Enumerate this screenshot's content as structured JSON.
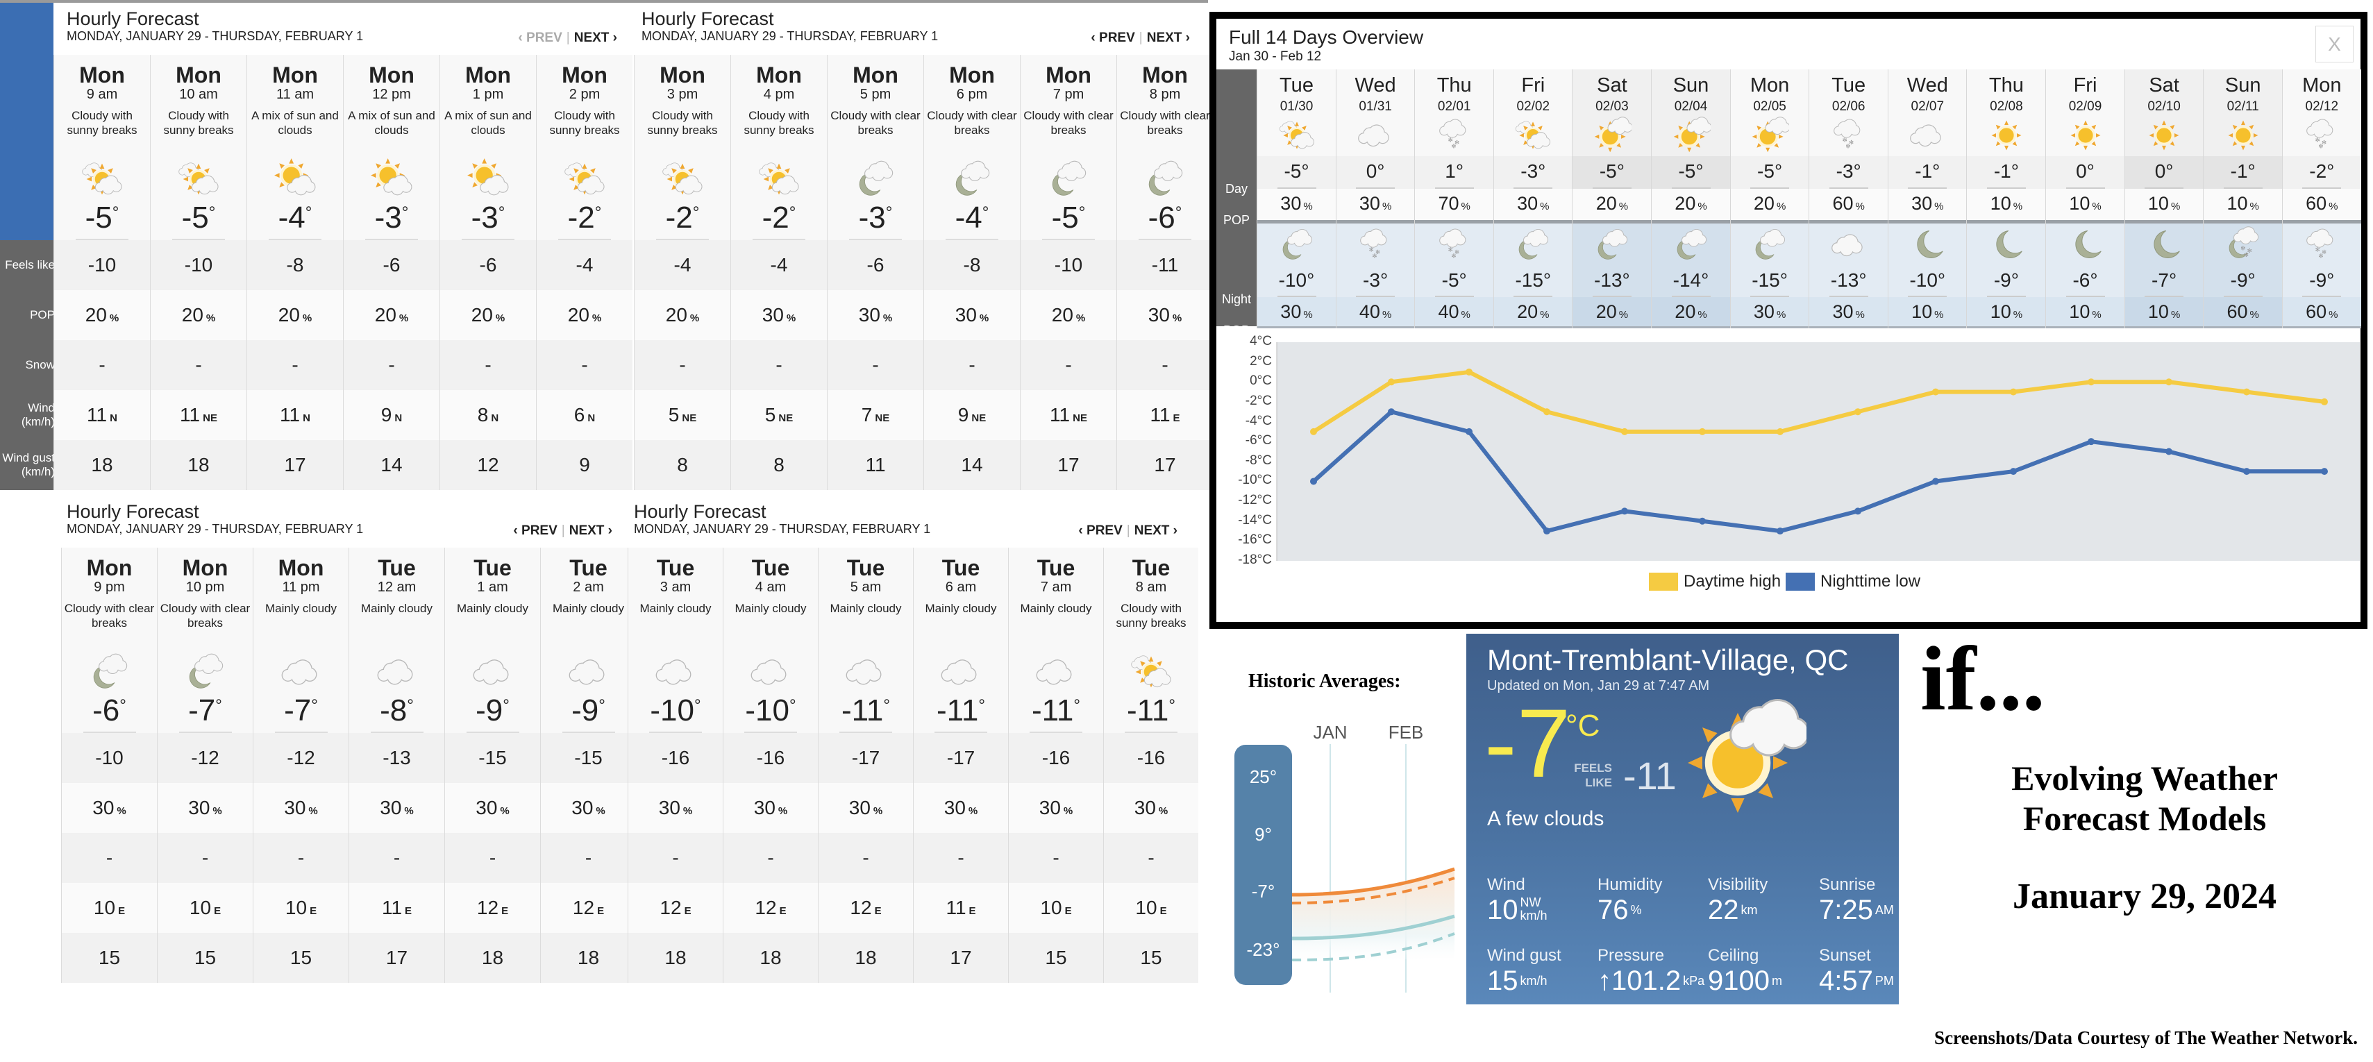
{
  "units": {
    "deg": "°",
    "pct": "%"
  },
  "hourly": {
    "row_labels": [
      "Feels like",
      "POP",
      "Snow",
      "Wind\n(km/h)",
      "Wind gust\n(km/h)"
    ],
    "panels": [
      {
        "title": "Hourly Forecast",
        "subtitle": "MONDAY, JANUARY 29 - THURSDAY, FEBRUARY 1",
        "prev": "‹ PREV",
        "next": "NEXT ›",
        "prev_disabled": true,
        "columns": [
          {
            "day": "Mon",
            "time": "9 am",
            "desc": "Cloudy with sunny breaks",
            "icon": "sun-cloud",
            "temp": "-5",
            "feels": "-10",
            "pop": "20",
            "snow": "-",
            "wind": "11",
            "dir": "N",
            "gust": "18"
          },
          {
            "day": "Mon",
            "time": "10 am",
            "desc": "Cloudy with sunny breaks",
            "icon": "sun-cloud",
            "temp": "-5",
            "feels": "-10",
            "pop": "20",
            "snow": "-",
            "wind": "11",
            "dir": "NE",
            "gust": "18"
          },
          {
            "day": "Mon",
            "time": "11 am",
            "desc": "A mix of sun and clouds",
            "icon": "mix-sun-cloud",
            "temp": "-4",
            "feels": "-8",
            "pop": "20",
            "snow": "-",
            "wind": "11",
            "dir": "N",
            "gust": "17"
          },
          {
            "day": "Mon",
            "time": "12 pm",
            "desc": "A mix of sun and clouds",
            "icon": "mix-sun-cloud",
            "temp": "-3",
            "feels": "-6",
            "pop": "20",
            "snow": "-",
            "wind": "9",
            "dir": "N",
            "gust": "14"
          },
          {
            "day": "Mon",
            "time": "1 pm",
            "desc": "A mix of sun and clouds",
            "icon": "mix-sun-cloud",
            "temp": "-3",
            "feels": "-6",
            "pop": "20",
            "snow": "-",
            "wind": "8",
            "dir": "N",
            "gust": "12"
          },
          {
            "day": "Mon",
            "time": "2 pm",
            "desc": "Cloudy with sunny breaks",
            "icon": "sun-cloud",
            "temp": "-2",
            "feels": "-4",
            "pop": "20",
            "snow": "-",
            "wind": "6",
            "dir": "N",
            "gust": "9"
          }
        ]
      },
      {
        "title": "Hourly Forecast",
        "subtitle": "MONDAY, JANUARY 29 - THURSDAY, FEBRUARY 1",
        "prev": "‹ PREV",
        "next": "NEXT ›",
        "prev_disabled": false,
        "columns": [
          {
            "day": "Mon",
            "time": "3 pm",
            "desc": "Cloudy with sunny breaks",
            "icon": "sun-cloud",
            "temp": "-2",
            "feels": "-4",
            "pop": "20",
            "snow": "-",
            "wind": "5",
            "dir": "NE",
            "gust": "8"
          },
          {
            "day": "Mon",
            "time": "4 pm",
            "desc": "Cloudy with sunny breaks",
            "icon": "sun-cloud",
            "temp": "-2",
            "feels": "-4",
            "pop": "30",
            "snow": "-",
            "wind": "5",
            "dir": "NE",
            "gust": "8"
          },
          {
            "day": "Mon",
            "time": "5 pm",
            "desc": "Cloudy with clear breaks",
            "icon": "moon-cloud",
            "temp": "-3",
            "feels": "-6",
            "pop": "30",
            "snow": "-",
            "wind": "7",
            "dir": "NE",
            "gust": "11"
          },
          {
            "day": "Mon",
            "time": "6 pm",
            "desc": "Cloudy with clear breaks",
            "icon": "moon-cloud",
            "temp": "-4",
            "feels": "-8",
            "pop": "30",
            "snow": "-",
            "wind": "9",
            "dir": "NE",
            "gust": "14"
          },
          {
            "day": "Mon",
            "time": "7 pm",
            "desc": "Cloudy with clear breaks",
            "icon": "moon-cloud",
            "temp": "-5",
            "feels": "-10",
            "pop": "20",
            "snow": "-",
            "wind": "11",
            "dir": "NE",
            "gust": "17"
          },
          {
            "day": "Mon",
            "time": "8 pm",
            "desc": "Cloudy with clear breaks",
            "icon": "moon-cloud",
            "temp": "-6",
            "feels": "-11",
            "pop": "30",
            "snow": "-",
            "wind": "11",
            "dir": "E",
            "gust": "17"
          }
        ]
      },
      {
        "title": "Hourly Forecast",
        "subtitle": "MONDAY, JANUARY 29 - THURSDAY, FEBRUARY 1",
        "prev": "‹ PREV",
        "next": "NEXT ›",
        "prev_disabled": false,
        "columns": [
          {
            "day": "Mon",
            "time": "9 pm",
            "desc": "Cloudy with clear breaks",
            "icon": "moon-cloud",
            "temp": "-6",
            "feels": "-10",
            "pop": "30",
            "snow": "-",
            "wind": "10",
            "dir": "E",
            "gust": "15"
          },
          {
            "day": "Mon",
            "time": "10 pm",
            "desc": "Cloudy with clear breaks",
            "icon": "moon-cloud",
            "temp": "-7",
            "feels": "-12",
            "pop": "30",
            "snow": "-",
            "wind": "10",
            "dir": "E",
            "gust": "15"
          },
          {
            "day": "Mon",
            "time": "11 pm",
            "desc": "Mainly cloudy",
            "icon": "cloud",
            "temp": "-7",
            "feels": "-12",
            "pop": "30",
            "snow": "-",
            "wind": "10",
            "dir": "E",
            "gust": "15"
          },
          {
            "day": "Tue",
            "time": "12 am",
            "desc": "Mainly cloudy",
            "icon": "cloud",
            "temp": "-8",
            "feels": "-13",
            "pop": "30",
            "snow": "-",
            "wind": "11",
            "dir": "E",
            "gust": "17"
          },
          {
            "day": "Tue",
            "time": "1 am",
            "desc": "Mainly cloudy",
            "icon": "cloud",
            "temp": "-9",
            "feels": "-15",
            "pop": "30",
            "snow": "-",
            "wind": "12",
            "dir": "E",
            "gust": "18"
          },
          {
            "day": "Tue",
            "time": "2 am",
            "desc": "Mainly cloudy",
            "icon": "cloud",
            "temp": "-9",
            "feels": "-15",
            "pop": "30",
            "snow": "-",
            "wind": "12",
            "dir": "E",
            "gust": "18"
          }
        ]
      },
      {
        "title": "Hourly Forecast",
        "subtitle": "MONDAY, JANUARY 29 - THURSDAY, FEBRUARY 1",
        "prev": "‹ PREV",
        "next": "NEXT ›",
        "prev_disabled": false,
        "columns": [
          {
            "day": "Tue",
            "time": "3 am",
            "desc": "Mainly cloudy",
            "icon": "cloud",
            "temp": "-10",
            "feels": "-16",
            "pop": "30",
            "snow": "-",
            "wind": "12",
            "dir": "E",
            "gust": "18"
          },
          {
            "day": "Tue",
            "time": "4 am",
            "desc": "Mainly cloudy",
            "icon": "cloud",
            "temp": "-10",
            "feels": "-16",
            "pop": "30",
            "snow": "-",
            "wind": "12",
            "dir": "E",
            "gust": "18"
          },
          {
            "day": "Tue",
            "time": "5 am",
            "desc": "Mainly cloudy",
            "icon": "cloud",
            "temp": "-11",
            "feels": "-17",
            "pop": "30",
            "snow": "-",
            "wind": "12",
            "dir": "E",
            "gust": "18"
          },
          {
            "day": "Tue",
            "time": "6 am",
            "desc": "Mainly cloudy",
            "icon": "cloud",
            "temp": "-11",
            "feels": "-17",
            "pop": "30",
            "snow": "-",
            "wind": "11",
            "dir": "E",
            "gust": "17"
          },
          {
            "day": "Tue",
            "time": "7 am",
            "desc": "Mainly cloudy",
            "icon": "cloud",
            "temp": "-11",
            "feels": "-16",
            "pop": "30",
            "snow": "-",
            "wind": "10",
            "dir": "E",
            "gust": "15"
          },
          {
            "day": "Tue",
            "time": "8 am",
            "desc": "Cloudy with sunny breaks",
            "icon": "sun-cloud",
            "temp": "-11",
            "feels": "-16",
            "pop": "30",
            "snow": "-",
            "wind": "10",
            "dir": "E",
            "gust": "15"
          }
        ]
      }
    ]
  },
  "fourteen_day": {
    "title": "Full 14 Days Overview",
    "subtitle": "Jan 30 - Feb 12",
    "close_label": "X",
    "labels": {
      "day": "Day",
      "pop": "POP",
      "night": "Night"
    },
    "days": [
      {
        "dow": "Tue",
        "date": "01/30",
        "day_icon": "sun-cloud",
        "day_temp": "-5°",
        "day_pop": "30",
        "night_icon": "moon-cloud",
        "night_temp": "-10°",
        "night_pop": "30",
        "weekend": false
      },
      {
        "dow": "Wed",
        "date": "01/31",
        "day_icon": "cloud",
        "day_temp": "0°",
        "day_pop": "30",
        "night_icon": "cloud-snow",
        "night_temp": "-3°",
        "night_pop": "40",
        "weekend": false
      },
      {
        "dow": "Thu",
        "date": "02/01",
        "day_icon": "cloud-snow",
        "day_temp": "1°",
        "day_pop": "70",
        "night_icon": "cloud-snow",
        "night_temp": "-5°",
        "night_pop": "40",
        "weekend": false
      },
      {
        "dow": "Fri",
        "date": "02/02",
        "day_icon": "sun-cloud",
        "day_temp": "-3°",
        "day_pop": "30",
        "night_icon": "moon-cloud",
        "night_temp": "-15°",
        "night_pop": "20",
        "weekend": false
      },
      {
        "dow": "Sat",
        "date": "02/03",
        "day_icon": "sun-few-clouds",
        "day_temp": "-5°",
        "day_pop": "20",
        "night_icon": "moon-cloud",
        "night_temp": "-13°",
        "night_pop": "20",
        "weekend": true
      },
      {
        "dow": "Sun",
        "date": "02/04",
        "day_icon": "sun-few-clouds",
        "day_temp": "-5°",
        "day_pop": "20",
        "night_icon": "moon-cloud",
        "night_temp": "-14°",
        "night_pop": "20",
        "weekend": true
      },
      {
        "dow": "Mon",
        "date": "02/05",
        "day_icon": "sun-few-clouds",
        "day_temp": "-5°",
        "day_pop": "20",
        "night_icon": "moon-cloud",
        "night_temp": "-15°",
        "night_pop": "30",
        "weekend": false
      },
      {
        "dow": "Tue",
        "date": "02/06",
        "day_icon": "cloud-snow",
        "day_temp": "-3°",
        "day_pop": "60",
        "night_icon": "cloud",
        "night_temp": "-13°",
        "night_pop": "30",
        "weekend": false
      },
      {
        "dow": "Wed",
        "date": "02/07",
        "day_icon": "cloud",
        "day_temp": "-1°",
        "day_pop": "30",
        "night_icon": "moon",
        "night_temp": "-10°",
        "night_pop": "10",
        "weekend": false
      },
      {
        "dow": "Thu",
        "date": "02/08",
        "day_icon": "sun",
        "day_temp": "-1°",
        "day_pop": "10",
        "night_icon": "moon",
        "night_temp": "-9°",
        "night_pop": "10",
        "weekend": false
      },
      {
        "dow": "Fri",
        "date": "02/09",
        "day_icon": "sun",
        "day_temp": "0°",
        "day_pop": "10",
        "night_icon": "moon",
        "night_temp": "-6°",
        "night_pop": "10",
        "weekend": false
      },
      {
        "dow": "Sat",
        "date": "02/10",
        "day_icon": "sun",
        "day_temp": "0°",
        "day_pop": "10",
        "night_icon": "moon",
        "night_temp": "-7°",
        "night_pop": "10",
        "weekend": true
      },
      {
        "dow": "Sun",
        "date": "02/11",
        "day_icon": "sun",
        "day_temp": "-1°",
        "day_pop": "10",
        "night_icon": "moon-cloud-snow",
        "night_temp": "-9°",
        "night_pop": "60",
        "weekend": true
      },
      {
        "dow": "Mon",
        "date": "02/12",
        "day_icon": "cloud-snow",
        "day_temp": "-2°",
        "day_pop": "60",
        "night_icon": "cloud-snow",
        "night_temp": "-9°",
        "night_pop": "60",
        "weekend": false
      }
    ]
  },
  "chart_data": {
    "type": "line",
    "ylim": [
      -18,
      4
    ],
    "yticks": [
      4,
      2,
      0,
      -2,
      -4,
      -6,
      -8,
      -10,
      -12,
      -14,
      -16,
      -18
    ],
    "ytick_labels": [
      "4°C",
      "2°C",
      "0°C",
      "-2°C",
      "-4°C",
      "-6°C",
      "-8°C",
      "-10°C",
      "-12°C",
      "-14°C",
      "-16°C",
      "-18°C"
    ],
    "grid": false,
    "legend": "bottom",
    "series": [
      {
        "name": "Daytime high",
        "color": "#f5cb42",
        "values": [
          -5,
          0,
          1,
          -3,
          -5,
          -5,
          -5,
          -3,
          -1,
          -1,
          0,
          0,
          -1,
          -2
        ]
      },
      {
        "name": "Nighttime low",
        "color": "#4470b3",
        "values": [
          -10,
          -3,
          -5,
          -15,
          -13,
          -14,
          -15,
          -13,
          -10,
          -9,
          -6,
          -7,
          -9,
          -9
        ]
      }
    ]
  },
  "current": {
    "city": "Mont-Tremblant-Village, QC",
    "updated": "Updated on Mon, Jan 29 at 7:47 AM",
    "temp": "-7",
    "unit": "°C",
    "feels_label": "FEELS\nLIKE",
    "feels": "-11",
    "condition": "A few clouds",
    "icon": "sun-few-clouds",
    "temp_color": "#f8ea4f",
    "stats": [
      {
        "label": "Wind",
        "value": "10",
        "unit_top": "NW",
        "unit": "km/h"
      },
      {
        "label": "Humidity",
        "value": "76",
        "unit": "%"
      },
      {
        "label": "Visibility",
        "value": "22",
        "unit": "km"
      },
      {
        "label": "Sunrise",
        "value": "7:25",
        "unit": "AM"
      },
      {
        "label": "Wind gust",
        "value": "15",
        "unit": "km/h"
      },
      {
        "label": "Pressure",
        "value": "↑101.2",
        "unit": "kPa"
      },
      {
        "label": "Ceiling",
        "value": "9100",
        "unit": "m"
      },
      {
        "label": "Sunset",
        "value": "4:57",
        "unit": "PM"
      }
    ]
  },
  "historic": {
    "title": "Historic Averages:",
    "months": [
      "JAN",
      "FEB"
    ],
    "scale": [
      "25°",
      "9°",
      "-7°",
      "-23°"
    ],
    "colors": {
      "high": "#ef8a3a",
      "low": "#9fd0d2",
      "scale_bg": "#4f7ea6"
    }
  },
  "captions": {
    "if": "if...",
    "headline_1": "Evolving Weather",
    "headline_2": "Forecast Models",
    "date": "January 29, 2024",
    "credit": "Screenshots/Data Courtesy of The Weather Network."
  },
  "colors": {
    "hourly_accent": "#3b6eb3",
    "label_gray": "#666666",
    "night_bg": "#e3ebf3",
    "night_weekend_bg": "#d3e0ec"
  }
}
